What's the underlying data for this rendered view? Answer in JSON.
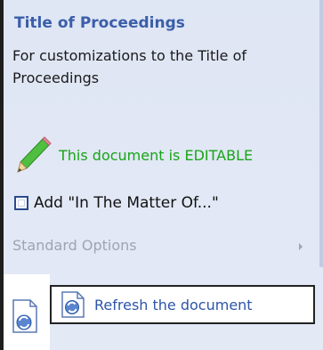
{
  "panel": {
    "title": "Title of Proceedings",
    "description": "For customizations to the Title of Proceedings",
    "status": {
      "text": "This document is EDITABLE",
      "icon": "pencil-icon",
      "color": "#18a518"
    },
    "checkbox": {
      "label": "Add \"In The Matter Of...\"",
      "checked": false
    },
    "standard_options": {
      "label": "Standard Options",
      "enabled": false,
      "icon": "chevron-right-icon"
    },
    "refresh": {
      "label": "Refresh the document",
      "icon": "refresh-document-icon"
    }
  },
  "colors": {
    "title": "#3b5ea9",
    "panel_bg": "#e0e6f4",
    "disabled_text": "#9ea5b2",
    "link_blue": "#2d55a8"
  }
}
